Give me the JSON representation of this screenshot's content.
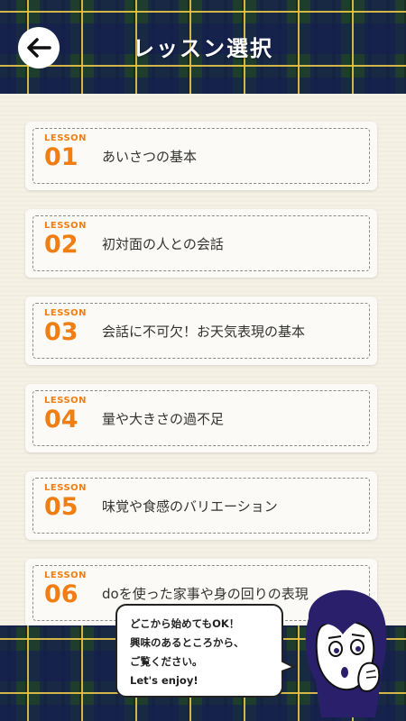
{
  "header": {
    "title": "レッスン選択",
    "back_icon": "arrow-left-icon"
  },
  "lessons": [
    {
      "tag": "LESSON",
      "number": "01",
      "title": "あいさつの基本"
    },
    {
      "tag": "LESSON",
      "number": "02",
      "title": "初対面の人との会話"
    },
    {
      "tag": "LESSON",
      "number": "03",
      "title": "会話に不可欠！お天気表現の基本"
    },
    {
      "tag": "LESSON",
      "number": "04",
      "title": "量や大きさの過不足"
    },
    {
      "tag": "LESSON",
      "number": "05",
      "title": "味覚や食感のバリエーション"
    },
    {
      "tag": "LESSON",
      "number": "06",
      "title": "doを使った家事や身の回りの表現"
    }
  ],
  "guide": {
    "lines": [
      "どこから始めてもOK！",
      "興味のあるところから、",
      "ご覧ください。",
      "Let's enjoy!"
    ]
  },
  "colors": {
    "accent": "#f07e12",
    "tartan_green": "#1f3d2c",
    "tartan_navy": "#1e2a55",
    "tartan_yellow": "#e8c44a"
  }
}
